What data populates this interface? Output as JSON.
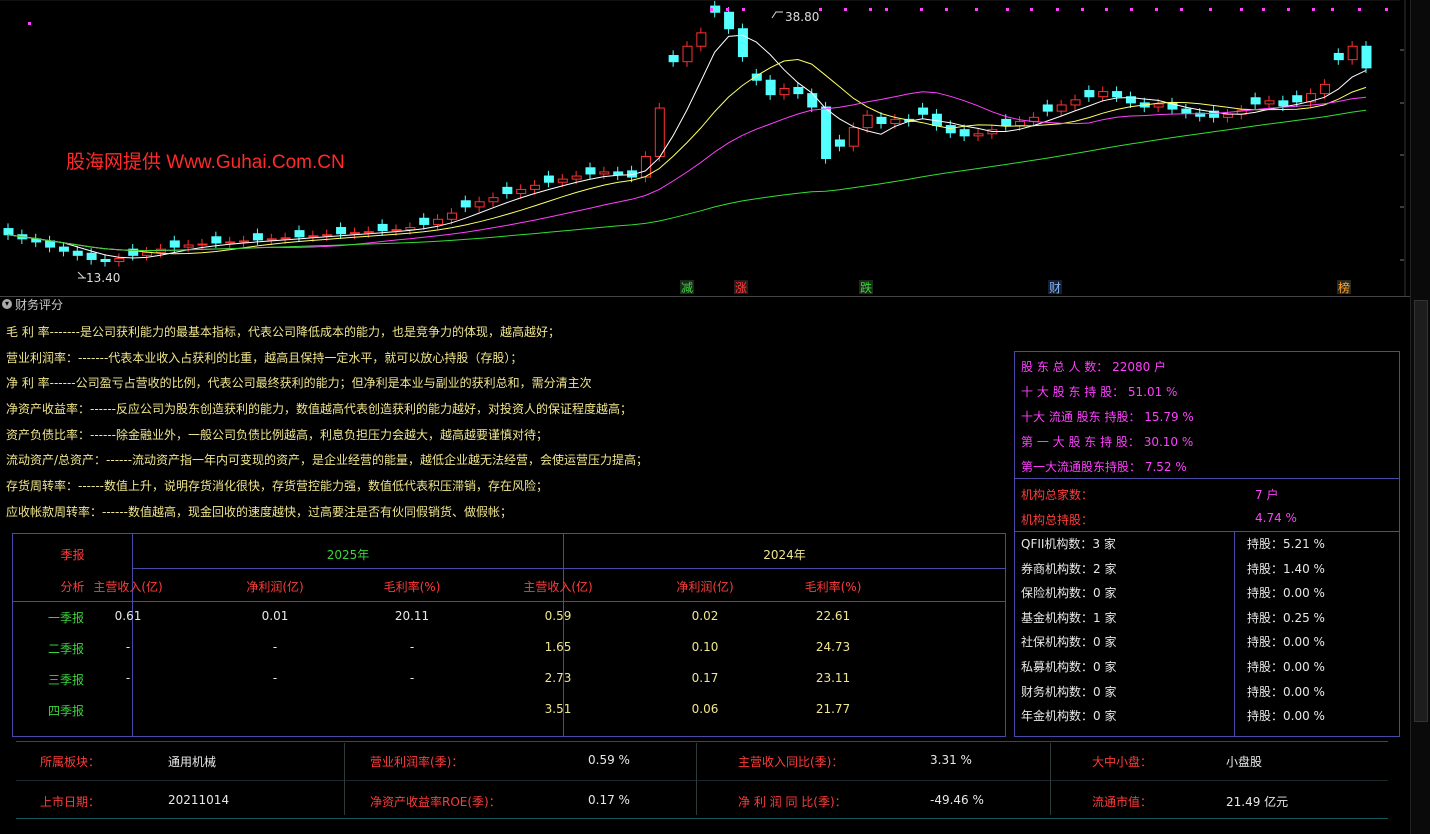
{
  "chart": {
    "watermark": "股海网提供 Www.Guhai.Com.CN",
    "high_label": "38.80",
    "low_label": "13.40",
    "markers": [
      "减",
      "涨",
      "跌",
      "财",
      "榜"
    ],
    "axis_ticks": [
      "3",
      "3",
      "2",
      "2",
      "1"
    ],
    "colors": {
      "up": "#ff3030",
      "down": "#54ffff",
      "ma5": "#ffffff",
      "ma10": "#ffff66",
      "ma20": "#ff40ff",
      "ma60": "#33dd33"
    }
  },
  "panel": {
    "title": "财务评分"
  },
  "descriptions": [
    "毛 利 率-------是公司获利能力的最基本指标，代表公司降低成本的能力，也是竞争力的体现，越高越好；",
    "营业利润率：-------代表本业收入占获利的比重，越高且保持一定水平，就可以放心持股（存股）；",
    "净 利 率------公司盈亏占营收的比例，代表公司最终获利的能力；但净利是本业与副业的获利总和，需分清主次",
    "净资产收益率：------反应公司为股东创造获利的能力，数值越高代表创造获利的能力越好，对投资人的保证程度越高；",
    "资产负债比率：------除金融业外，一般公司负债比例越高，利息负担压力会越大，越高越要谨慎对待；",
    "流动资产/总资产：------流动资产指一年内可变现的资产，是企业经营的能量，越低企业越无法经营，会使运营压力提高；",
    "存货周转率：------数值上升，说明存货消化很快，存货营控能力强，数值低代表积压滞销，存在风险；",
    "应收帐款周转率：------数值越高，现金回收的速度越快，过高要注是否有伙同假销货、做假帐；"
  ],
  "holders": {
    "summary": [
      "股 东 总 人 数： 22080 户",
      "十 大 股 东 持 股： 51.01 %",
      "十大 流通 股东 持股： 15.79 %",
      "第 一 大 股 东 持 股： 30.10 %",
      "第一大流通股东持股： 7.52 %"
    ],
    "inst_total_label": "机构总家数：",
    "inst_total_value": "7 户",
    "inst_hold_label": "机构总持股：",
    "inst_hold_value": "4.74 %",
    "institutions": [
      {
        "name": "QFII机构数：3 家",
        "hold": "持股：5.21 %"
      },
      {
        "name": "券商机构数：2 家",
        "hold": "持股：1.40 %"
      },
      {
        "name": "保险机构数：0 家",
        "hold": "持股：0.00 %"
      },
      {
        "name": "基金机构数：1 家",
        "hold": "持股：0.25 %"
      },
      {
        "name": "社保机构数：0 家",
        "hold": "持股：0.00 %"
      },
      {
        "name": "私募机构数：0 家",
        "hold": "持股：0.00 %"
      },
      {
        "name": "财务机构数：0 家",
        "hold": "持股：0.00 %"
      },
      {
        "name": "年金机构数：0 家",
        "hold": "持股：0.00 %"
      }
    ]
  },
  "report": {
    "corner_top": "季报",
    "corner_bottom": "分析",
    "years": [
      "2025年",
      "2024年"
    ],
    "columns": [
      "主营收入(亿)",
      "净利润(亿)",
      "毛利率(%)",
      "主营收入(亿)",
      "净利润(亿)",
      "毛利率(%)"
    ],
    "rows": [
      {
        "label": "一季报",
        "values": [
          "0.61",
          "0.01",
          "20.11",
          "0.59",
          "0.02",
          "22.61"
        ]
      },
      {
        "label": "二季报",
        "values": [
          "-",
          "-",
          "-",
          "1.65",
          "0.10",
          "24.73"
        ]
      },
      {
        "label": "三季报",
        "values": [
          "-",
          "-",
          "-",
          "2.73",
          "0.17",
          "23.11"
        ]
      },
      {
        "label": "四季报",
        "values": [
          "",
          "",
          "",
          "3.51",
          "0.06",
          "21.77"
        ]
      }
    ]
  },
  "bottom": {
    "row1": [
      {
        "label": "所属板块：",
        "value": "通用机械"
      },
      {
        "label": "营业利润率(季)：",
        "value": "0.59 %"
      },
      {
        "label": "主营收入同比(季)：",
        "value": "3.31 %"
      },
      {
        "label": "大中小盘：",
        "value": "小盘股"
      }
    ],
    "row2": [
      {
        "label": "上市日期：",
        "value": "20211014"
      },
      {
        "label": "净资产收益率ROE(季)：",
        "value": "0.17 %"
      },
      {
        "label": "净 利 润 同 比(季)：",
        "value": "-49.46 %"
      },
      {
        "label": "流通市值：",
        "value": "21.49 亿元"
      }
    ]
  }
}
